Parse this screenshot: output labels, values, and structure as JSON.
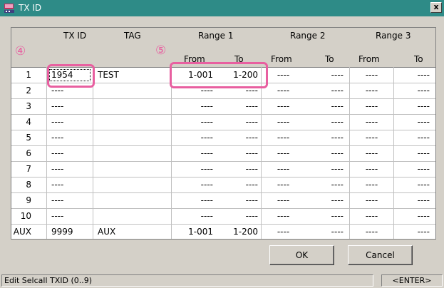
{
  "window": {
    "title": "TX ID",
    "close_label": "x"
  },
  "annotations": {
    "circle_4": "④",
    "circle_5": "⑤"
  },
  "headers": {
    "tx_id": "TX ID",
    "tag": "TAG",
    "range1": "Range 1",
    "range2": "Range 2",
    "range3": "Range 3",
    "from": "From",
    "to": "To"
  },
  "rows": [
    {
      "num": "1",
      "txid": "1954",
      "tag": "TEST",
      "r1from": "1-001",
      "r1to": "1-200",
      "r2from": "----",
      "r2to": "----",
      "r3from": "----",
      "r3to": "----"
    },
    {
      "num": "2",
      "txid": "----",
      "tag": "",
      "r1from": "----",
      "r1to": "----",
      "r2from": "----",
      "r2to": "----",
      "r3from": "----",
      "r3to": "----"
    },
    {
      "num": "3",
      "txid": "----",
      "tag": "",
      "r1from": "----",
      "r1to": "----",
      "r2from": "----",
      "r2to": "----",
      "r3from": "----",
      "r3to": "----"
    },
    {
      "num": "4",
      "txid": "----",
      "tag": "",
      "r1from": "----",
      "r1to": "----",
      "r2from": "----",
      "r2to": "----",
      "r3from": "----",
      "r3to": "----"
    },
    {
      "num": "5",
      "txid": "----",
      "tag": "",
      "r1from": "----",
      "r1to": "----",
      "r2from": "----",
      "r2to": "----",
      "r3from": "----",
      "r3to": "----"
    },
    {
      "num": "6",
      "txid": "----",
      "tag": "",
      "r1from": "----",
      "r1to": "----",
      "r2from": "----",
      "r2to": "----",
      "r3from": "----",
      "r3to": "----"
    },
    {
      "num": "7",
      "txid": "----",
      "tag": "",
      "r1from": "----",
      "r1to": "----",
      "r2from": "----",
      "r2to": "----",
      "r3from": "----",
      "r3to": "----"
    },
    {
      "num": "8",
      "txid": "----",
      "tag": "",
      "r1from": "----",
      "r1to": "----",
      "r2from": "----",
      "r2to": "----",
      "r3from": "----",
      "r3to": "----"
    },
    {
      "num": "9",
      "txid": "----",
      "tag": "",
      "r1from": "----",
      "r1to": "----",
      "r2from": "----",
      "r2to": "----",
      "r3from": "----",
      "r3to": "----"
    },
    {
      "num": "10",
      "txid": "----",
      "tag": "",
      "r1from": "----",
      "r1to": "----",
      "r2from": "----",
      "r2to": "----",
      "r3from": "----",
      "r3to": "----"
    },
    {
      "num": "AUX",
      "txid": "9999",
      "tag": "AUX",
      "r1from": "1-001",
      "r1to": "1-200",
      "r2from": "----",
      "r2to": "----",
      "r3from": "----",
      "r3to": "----"
    }
  ],
  "buttons": {
    "ok": "OK",
    "cancel": "Cancel"
  },
  "status": {
    "message": "Edit Selcall TXID (0..9)",
    "key": "<ENTER>"
  },
  "colors": {
    "titlebar": "#2e8b87",
    "highlight": "#e85fa0",
    "face": "#d4d0c8"
  }
}
